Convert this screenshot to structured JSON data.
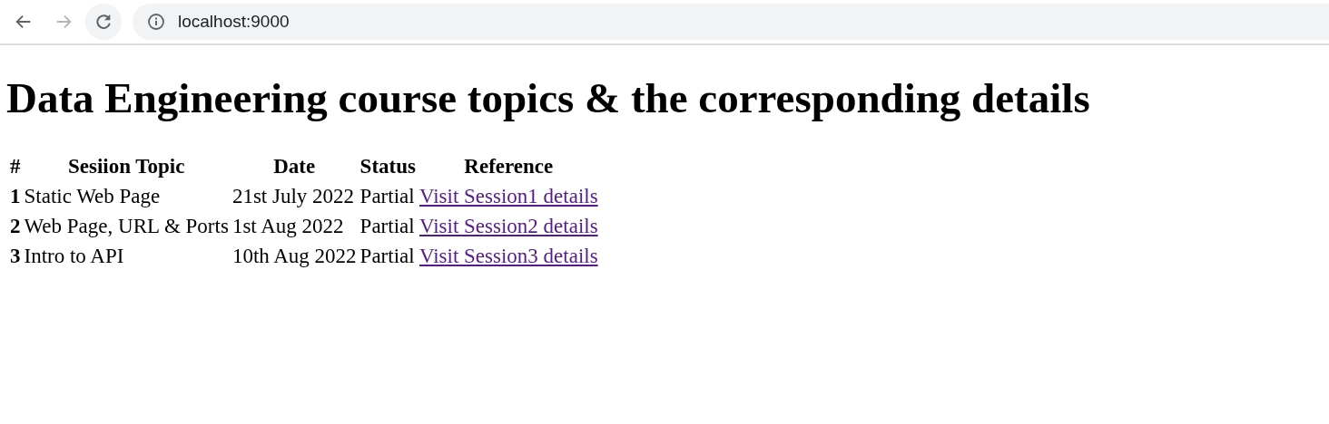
{
  "browser": {
    "nav": [
      {
        "kind": "back",
        "disabled": false
      },
      {
        "kind": "forward",
        "disabled": true
      },
      {
        "kind": "reload",
        "disabled": false
      }
    ],
    "address": "localhost:9000"
  },
  "heading": "Data Engineering course topics & the corresponding details",
  "table": {
    "columns": [
      "#",
      "Sesiion Topic",
      "Date",
      "Status",
      "Reference"
    ],
    "rows": [
      [
        "1",
        "Static Web Page",
        "21st July 2022",
        "Partial",
        "Visit Session1 details"
      ],
      [
        "2",
        "Web Page, URL & Ports",
        "1st Aug 2022",
        "Partial",
        "Visit Session2 details"
      ],
      [
        "3",
        "Intro to API",
        "10th Aug 2022",
        "Partial",
        "Visit Session3 details"
      ]
    ]
  }
}
